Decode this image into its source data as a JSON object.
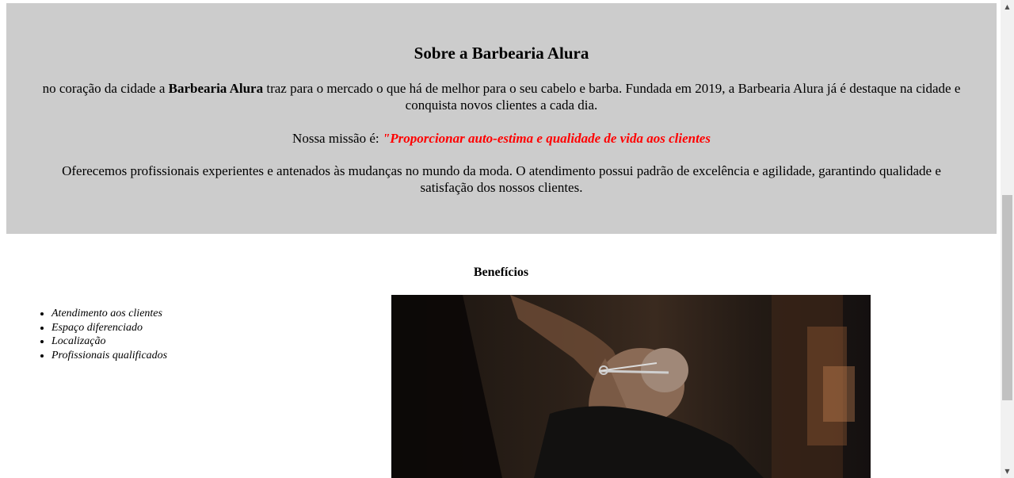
{
  "about": {
    "title": "Sobre a Barbearia Alura",
    "intro_prefix": "no coração da cidade a ",
    "intro_brand": "Barbearia Alura",
    "intro_suffix": " traz para o mercado o que há de melhor para o seu cabelo e barba. Fundada em 2019, a Barbearia Alura já é destaque na cidade e conquista novos clientes a cada dia.",
    "mission_label": "Nossa missão é: ",
    "mission_quote": "\"Proporcionar auto-estima e qualidade de vida aos clientes",
    "offer_text": "Oferecemos profissionais experientes e antenados às mudanças no mundo da moda. O atendimento possui padrão de excelência e agilidade, garantindo qualidade e satisfação dos nossos clientes.",
    "background_color": "#cccccc",
    "mission_color": "#ff0000"
  },
  "benefits": {
    "title": "Benefícios",
    "items": [
      "Atendimento aos clientes",
      "Espaço diferenciado",
      "Localização",
      "Profissionais qualificados"
    ]
  },
  "scrollbar": {
    "up_icon": "▲",
    "down_icon": "▼"
  }
}
